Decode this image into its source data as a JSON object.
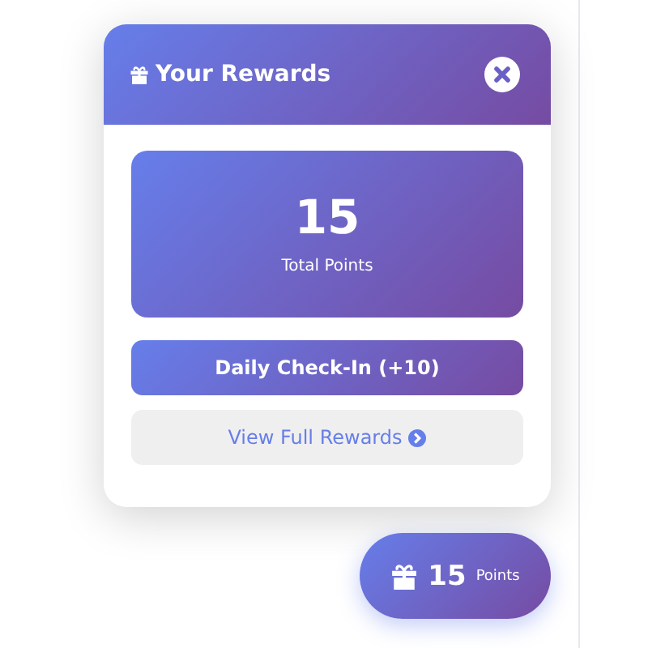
{
  "panel": {
    "title": "Your Rewards",
    "points": "15",
    "points_label": "Total Points",
    "checkin_button": "Daily Check-In (+10)",
    "view_button": "View Full Rewards"
  },
  "floating_button": {
    "points": "15",
    "label": "Points"
  }
}
